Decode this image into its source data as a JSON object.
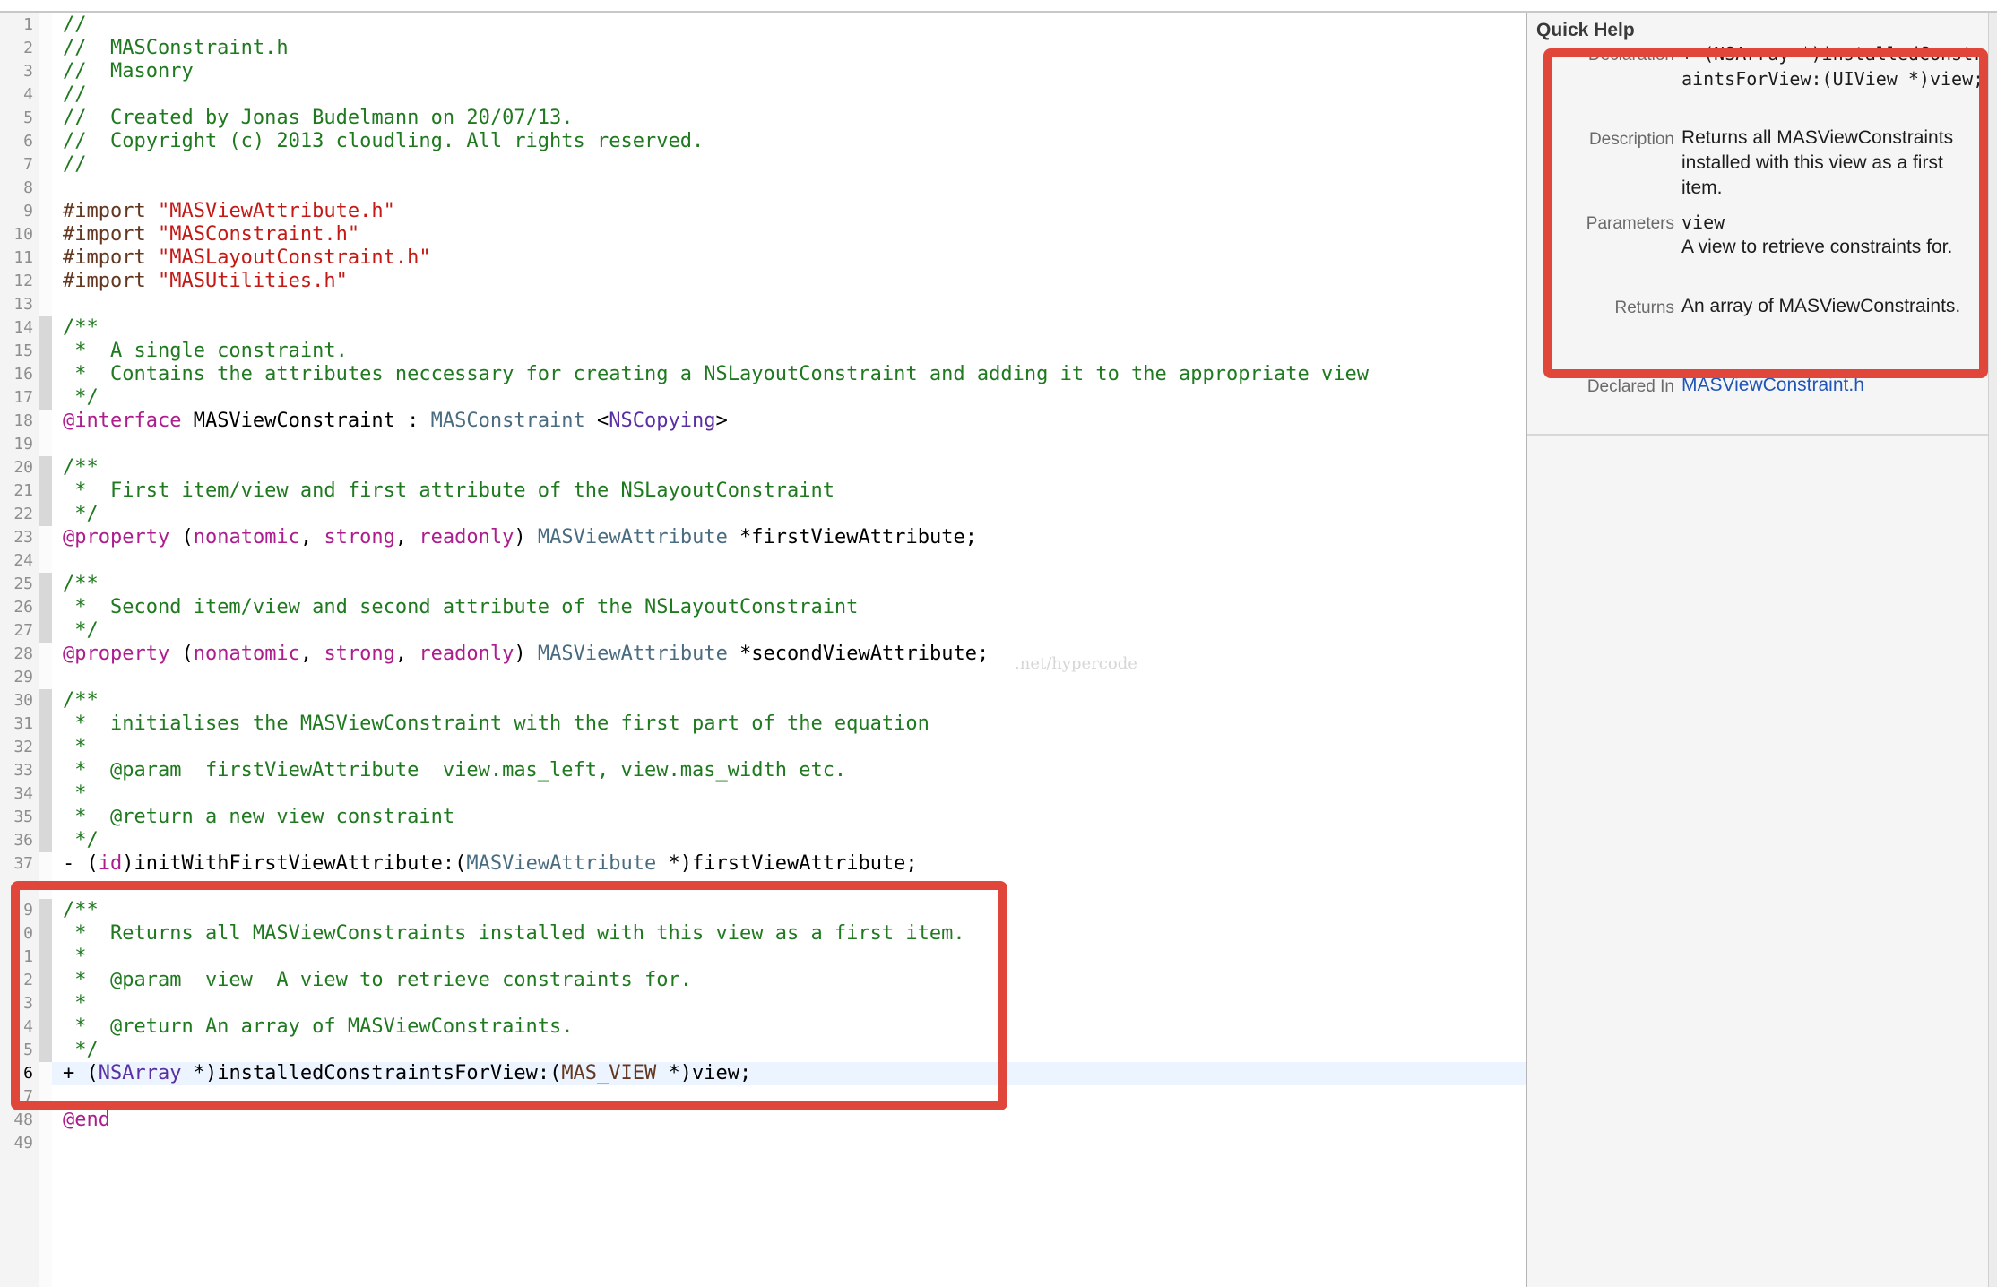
{
  "editor": {
    "lines": [
      {
        "n": "1",
        "tokens": [
          {
            "c": "c",
            "t": "//"
          }
        ]
      },
      {
        "n": "2",
        "tokens": [
          {
            "c": "c",
            "t": "//  MASConstraint.h"
          }
        ]
      },
      {
        "n": "3",
        "tokens": [
          {
            "c": "c",
            "t": "//  Masonry"
          }
        ]
      },
      {
        "n": "4",
        "tokens": [
          {
            "c": "c",
            "t": "//"
          }
        ]
      },
      {
        "n": "5",
        "tokens": [
          {
            "c": "c",
            "t": "//  Created by Jonas Budelmann on 20/07/13."
          }
        ]
      },
      {
        "n": "6",
        "tokens": [
          {
            "c": "c",
            "t": "//  Copyright (c) 2013 cloudling. All rights reserved."
          }
        ]
      },
      {
        "n": "7",
        "tokens": [
          {
            "c": "c",
            "t": "//"
          }
        ]
      },
      {
        "n": "8",
        "tokens": []
      },
      {
        "n": "9",
        "tokens": [
          {
            "c": "d",
            "t": "#import "
          },
          {
            "c": "s",
            "t": "\"MASViewAttribute.h\""
          }
        ]
      },
      {
        "n": "10",
        "tokens": [
          {
            "c": "d",
            "t": "#import "
          },
          {
            "c": "s",
            "t": "\"MASConstraint.h\""
          }
        ]
      },
      {
        "n": "11",
        "tokens": [
          {
            "c": "d",
            "t": "#import "
          },
          {
            "c": "s",
            "t": "\"MASLayoutConstraint.h\""
          }
        ]
      },
      {
        "n": "12",
        "tokens": [
          {
            "c": "d",
            "t": "#import "
          },
          {
            "c": "s",
            "t": "\"MASUtilities.h\""
          }
        ]
      },
      {
        "n": "13",
        "tokens": []
      },
      {
        "n": "14",
        "tokens": [
          {
            "c": "c",
            "t": "/**"
          }
        ]
      },
      {
        "n": "15",
        "tokens": [
          {
            "c": "c",
            "t": " *  A single constraint."
          }
        ]
      },
      {
        "n": "16",
        "tokens": [
          {
            "c": "c",
            "t": " *  Contains the attributes neccessary for creating a NSLayoutConstraint and adding it to the appropriate view"
          }
        ]
      },
      {
        "n": "17",
        "tokens": [
          {
            "c": "c",
            "t": " */"
          }
        ]
      },
      {
        "n": "18",
        "tokens": [
          {
            "c": "k",
            "t": "@interface"
          },
          {
            "c": "n",
            "t": " MASViewConstraint : "
          },
          {
            "c": "t",
            "t": "MASConstraint"
          },
          {
            "c": "n",
            "t": " <"
          },
          {
            "c": "p",
            "t": "NSCopying"
          },
          {
            "c": "n",
            "t": ">"
          }
        ]
      },
      {
        "n": "19",
        "tokens": []
      },
      {
        "n": "20",
        "tokens": [
          {
            "c": "c",
            "t": "/**"
          }
        ]
      },
      {
        "n": "21",
        "tokens": [
          {
            "c": "c",
            "t": " *  First item/view and first attribute of the NSLayoutConstraint"
          }
        ]
      },
      {
        "n": "22",
        "tokens": [
          {
            "c": "c",
            "t": " */"
          }
        ]
      },
      {
        "n": "23",
        "tokens": [
          {
            "c": "k",
            "t": "@property"
          },
          {
            "c": "n",
            "t": " ("
          },
          {
            "c": "k",
            "t": "nonatomic"
          },
          {
            "c": "n",
            "t": ", "
          },
          {
            "c": "k",
            "t": "strong"
          },
          {
            "c": "n",
            "t": ", "
          },
          {
            "c": "k",
            "t": "readonly"
          },
          {
            "c": "n",
            "t": ") "
          },
          {
            "c": "t",
            "t": "MASViewAttribute"
          },
          {
            "c": "n",
            "t": " *firstViewAttribute;"
          }
        ]
      },
      {
        "n": "24",
        "tokens": []
      },
      {
        "n": "25",
        "tokens": [
          {
            "c": "c",
            "t": "/**"
          }
        ]
      },
      {
        "n": "26",
        "tokens": [
          {
            "c": "c",
            "t": " *  Second item/view and second attribute of the NSLayoutConstraint"
          }
        ]
      },
      {
        "n": "27",
        "tokens": [
          {
            "c": "c",
            "t": " */"
          }
        ]
      },
      {
        "n": "28",
        "tokens": [
          {
            "c": "k",
            "t": "@property"
          },
          {
            "c": "n",
            "t": " ("
          },
          {
            "c": "k",
            "t": "nonatomic"
          },
          {
            "c": "n",
            "t": ", "
          },
          {
            "c": "k",
            "t": "strong"
          },
          {
            "c": "n",
            "t": ", "
          },
          {
            "c": "k",
            "t": "readonly"
          },
          {
            "c": "n",
            "t": ") "
          },
          {
            "c": "t",
            "t": "MASViewAttribute"
          },
          {
            "c": "n",
            "t": " *secondViewAttribute;"
          }
        ]
      },
      {
        "n": "29",
        "tokens": []
      },
      {
        "n": "30",
        "tokens": [
          {
            "c": "c",
            "t": "/**"
          }
        ]
      },
      {
        "n": "31",
        "tokens": [
          {
            "c": "c",
            "t": " *  initialises the MASViewConstraint with the first part of the equation"
          }
        ]
      },
      {
        "n": "32",
        "tokens": [
          {
            "c": "c",
            "t": " *"
          }
        ]
      },
      {
        "n": "33",
        "tokens": [
          {
            "c": "c",
            "t": " *  @param  firstViewAttribute  view.mas_left, view.mas_width etc."
          }
        ]
      },
      {
        "n": "34",
        "tokens": [
          {
            "c": "c",
            "t": " *"
          }
        ]
      },
      {
        "n": "35",
        "tokens": [
          {
            "c": "c",
            "t": " *  @return a new view constraint"
          }
        ]
      },
      {
        "n": "36",
        "tokens": [
          {
            "c": "c",
            "t": " */"
          }
        ]
      },
      {
        "n": "37",
        "tokens": [
          {
            "c": "n",
            "t": "- ("
          },
          {
            "c": "k",
            "t": "id"
          },
          {
            "c": "n",
            "t": ")initWithFirstViewAttribute:("
          },
          {
            "c": "t",
            "t": "MASViewAttribute"
          },
          {
            "c": "n",
            "t": " *)firstViewAttribute;"
          }
        ]
      },
      {
        "n": "",
        "tokens": []
      },
      {
        "n": "9",
        "tokens": [
          {
            "c": "c",
            "t": "/**"
          }
        ]
      },
      {
        "n": "0",
        "tokens": [
          {
            "c": "c",
            "t": " *  Returns all MASViewConstraints installed with this view as a first item."
          }
        ]
      },
      {
        "n": "1",
        "tokens": [
          {
            "c": "c",
            "t": " *"
          }
        ]
      },
      {
        "n": "2",
        "tokens": [
          {
            "c": "c",
            "t": " *  @param  view  A view to retrieve constraints for."
          }
        ]
      },
      {
        "n": "3",
        "tokens": [
          {
            "c": "c",
            "t": " *"
          }
        ]
      },
      {
        "n": "4",
        "tokens": [
          {
            "c": "c",
            "t": " *  @return An array of MASViewConstraints."
          }
        ]
      },
      {
        "n": "5",
        "tokens": [
          {
            "c": "c",
            "t": " */"
          }
        ]
      },
      {
        "n": "6",
        "tokens": [
          {
            "c": "n",
            "t": "+ ("
          },
          {
            "c": "p",
            "t": "NSArray"
          },
          {
            "c": "n",
            "t": " *)installedConstraintsForView:("
          },
          {
            "c": "d",
            "t": "MAS_VIEW"
          },
          {
            "c": "n",
            "t": " *)view;"
          }
        ],
        "current": true
      },
      {
        "n": "7",
        "tokens": []
      },
      {
        "n": "48",
        "tokens": [
          {
            "c": "k",
            "t": "@end"
          }
        ]
      },
      {
        "n": "49",
        "tokens": []
      }
    ],
    "watermark": ".net/hypercode"
  },
  "quick_help": {
    "title": "Quick Help",
    "declaration_label": "Declaration",
    "declaration": "+ (NSArray *)installedConstraintsForView:(UIView *)view;",
    "description_label": "Description",
    "description": "Returns all MASViewConstraints installed with this view as a first item.",
    "parameters_label": "Parameters",
    "param_name": "view",
    "param_desc": "A view to retrieve constraints for.",
    "returns_label": "Returns",
    "returns": "An array of MASViewConstraints.",
    "declared_in_label": "Declared In",
    "declared_in": "MASViewConstraint.h"
  },
  "colors": {
    "highlight_box": "#e0473a",
    "comment": "#1f7a1f",
    "keyword": "#ad1d8e",
    "string": "#c41a16",
    "link": "#1f55b7"
  }
}
